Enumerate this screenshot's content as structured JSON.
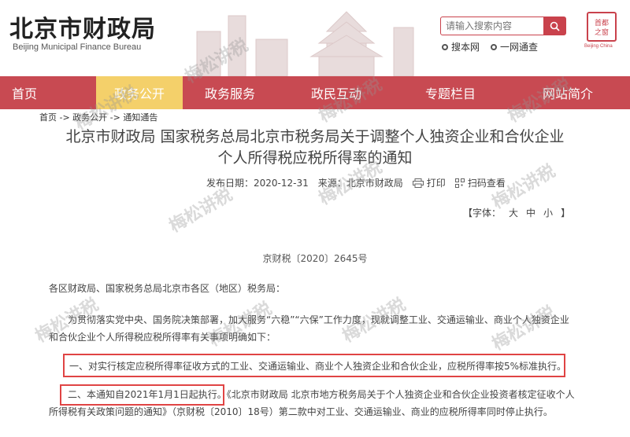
{
  "header": {
    "title": "北京市财政局",
    "subtitle": "Beijing Municipal Finance Bureau",
    "search_placeholder": "请输入搜索内容",
    "quick_links": [
      "搜本网",
      "一网通查"
    ],
    "seal_caption": "Beijing·China"
  },
  "nav": {
    "items": [
      "首页",
      "政务公开",
      "政务服务",
      "政民互动",
      "专题栏目",
      "网站简介"
    ],
    "active_index": 1
  },
  "breadcrumb": "首页 -> 政务公开 -> 通知通告",
  "article": {
    "title_line1": "北京市财政局 国家税务总局北京市税务局关于调整个人独资企业和合伙企业",
    "title_line2": "个人所得税应税所得率的通知",
    "publish_label": "发布日期：",
    "publish_date": "2020-12-31",
    "source_label": "来源：",
    "source": "北京市财政局",
    "print_label": "打印",
    "scan_label": "扫码查看",
    "font_label": "【字体：",
    "font_sizes": [
      "大",
      "中",
      "小"
    ],
    "font_close": "】",
    "doc_no": "京财税〔2020〕2645号",
    "p1": "各区财政局、国家税务总局北京市各区（地区）税务局：",
    "p2": "为贯彻落实党中央、国务院决策部署，加大服务“六稳”“六保”工作力度，现就调整工业、交通运输业、商业个人独资企业和合伙企业个人所得税应税所得率有关事项明确如下：",
    "p3": "一、对实行核定应税所得率征收方式的工业、交通运输业、商业个人独资企业和合伙企业，应税所得率按5%标准执行。",
    "p4": "二、本通知自2021年1月1日起执行。《北京市财政局 北京市地方税务局关于个人独资企业和合伙企业投资者核定征收个人所得税有关政策问题的通知》（京财税〔2010〕18号）第二款中对工业、交通运输业、商业的应税所得率同时停止执行。"
  },
  "watermark": "梅松讲税",
  "colors": {
    "nav": "#c84a52",
    "active": "#f4d06a",
    "highlight": "#e04444"
  }
}
